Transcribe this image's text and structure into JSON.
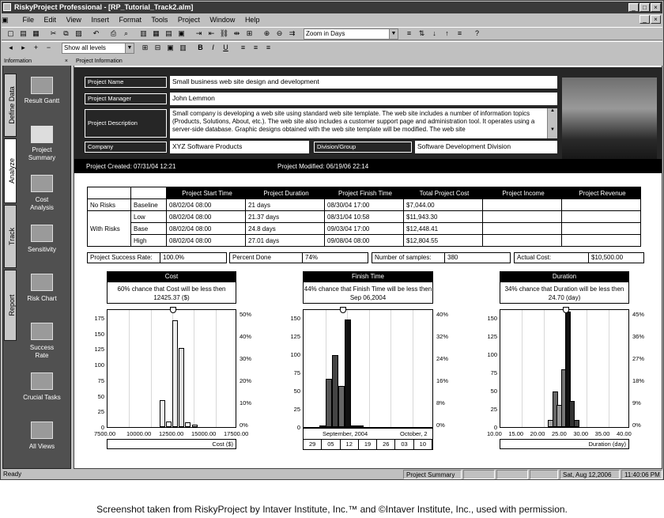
{
  "window": {
    "title": "RiskyProject Professional - [RP_Tutorial_Track2.alm]"
  },
  "menu": [
    "File",
    "Edit",
    "View",
    "Insert",
    "Format",
    "Tools",
    "Project",
    "Window",
    "Help"
  ],
  "toolbar": {
    "zoom_value": "Zoom in Days",
    "levels_value": "Show all levels",
    "bold": "B",
    "italic": "I",
    "underline": "U"
  },
  "sidebar": {
    "header": "Information",
    "tabs": [
      "Define Data",
      "Analyze",
      "Track",
      "Report"
    ],
    "items": [
      "Result Gantt",
      "Project Summary",
      "Cost Analysis",
      "Sensitivity",
      "Risk Chart",
      "Success Rate",
      "Crucial Tasks",
      "All Views"
    ]
  },
  "panel_header": "Project Information",
  "project": {
    "name_label": "Project Name",
    "name": "Small business web site design and development",
    "manager_label": "Project Manager",
    "manager": "John Lemmon",
    "description_label": "Project Description",
    "description": "Small company is developing a web site using standard web site template. The web site includes a number of information topics (Products, Solutions, About, etc.). The web site also includes a customer support page and administration tool. It operates using a server-side database. Graphic designs obtained with the web site template will be modified. The web site",
    "company_label": "Company",
    "company": "XYZ Software Products",
    "division_label": "Division/Group",
    "division": "Software Development Division",
    "created": "Project Created: 07/31/04 12:21",
    "modified": "Project Modified: 06/19/06 22:14"
  },
  "results": {
    "headers": [
      "",
      "",
      "Project Start Time",
      "Project Duration",
      "Project Finish Time",
      "Total Project Cost",
      "Project Income",
      "Project Revenue"
    ],
    "no_risks_label": "No Risks",
    "with_risks_label": "With Risks",
    "rows": [
      {
        "case": "Baseline",
        "start": "08/02/04 08:00",
        "duration": "21 days",
        "finish": "08/30/04 17:00",
        "cost": "$7,044.00"
      },
      {
        "case": "Low",
        "start": "08/02/04 08:00",
        "duration": "21.37 days",
        "finish": "08/31/04 10:58",
        "cost": "$11,943.30"
      },
      {
        "case": "Base",
        "start": "08/02/04 08:00",
        "duration": "24.8 days",
        "finish": "09/03/04 17:00",
        "cost": "$12,448.41"
      },
      {
        "case": "High",
        "start": "08/02/04 08:00",
        "duration": "27.01 days",
        "finish": "09/08/04 08:00",
        "cost": "$12,804.55"
      }
    ]
  },
  "stats": {
    "success_label": "Project Success Rate:",
    "success": "100.0%",
    "done_label": "Percent Done",
    "done": "74%",
    "samples_label": "Number of samples:",
    "samples": "380",
    "actual_label": "Actual Cost:",
    "actual": "$10,500.00"
  },
  "charts": [
    {
      "title": "Cost",
      "note": "60% chance that Cost will be less then 12425.37 ($)",
      "xbox": "Cost ($)",
      "xticks": [
        "7500.00",
        "10000.00",
        "12500.00",
        "15000.00",
        "17500.00"
      ],
      "yticks": [
        "175",
        "150",
        "125",
        "100",
        "75",
        "50",
        "25",
        "0"
      ],
      "ryticks": [
        "50%",
        "40%",
        "30%",
        "20%",
        "10%",
        "0%"
      ]
    },
    {
      "title": "Finish Time",
      "note": "44% chance that Finish Time will be less then Sep 06,2004",
      "xbox": "",
      "month_left": "September, 2004",
      "month_right": "October, 2",
      "days": [
        "29",
        "05",
        "12",
        "19",
        "26",
        "03",
        "10"
      ],
      "yticks": [
        "150",
        "125",
        "100",
        "75",
        "50",
        "25",
        "0"
      ],
      "ryticks": [
        "40%",
        "32%",
        "24%",
        "16%",
        "8%",
        "0%"
      ]
    },
    {
      "title": "Duration",
      "note": "34% chance that Duration will be less then 24.70 (day)",
      "xbox": "Duration (day)",
      "xticks": [
        "10.00",
        "15.00",
        "20.00",
        "25.00",
        "30.00",
        "35.00",
        "40.00"
      ],
      "yticks": [
        "150",
        "125",
        "100",
        "75",
        "50",
        "25",
        "0"
      ],
      "ryticks": [
        "45%",
        "36%",
        "27%",
        "18%",
        "9%",
        "0%"
      ]
    }
  ],
  "chart_data": [
    {
      "type": "bar",
      "title": "Cost",
      "xlabel": "Cost ($)",
      "xlim": [
        7500,
        17500
      ],
      "ylim": [
        0,
        200
      ],
      "x": [
        11500,
        12000,
        12500,
        13000,
        13500,
        14000
      ],
      "values": [
        45,
        10,
        180,
        133,
        8,
        4
      ]
    },
    {
      "type": "bar",
      "title": "Finish Time",
      "xlabel": "",
      "ylim": [
        0,
        160
      ],
      "x": [
        "08/31",
        "09/01",
        "09/02",
        "09/03",
        "09/06",
        "09/07",
        "09/08"
      ],
      "values": [
        2,
        65,
        97,
        55,
        145,
        2,
        1
      ]
    },
    {
      "type": "bar",
      "title": "Duration",
      "xlabel": "Duration (day)",
      "xlim": [
        10,
        40
      ],
      "ylim": [
        0,
        160
      ],
      "x": [
        21,
        22,
        23,
        24,
        25,
        26,
        27
      ],
      "values": [
        10,
        48,
        30,
        78,
        163,
        35,
        10
      ]
    }
  ],
  "status": {
    "ready": "Ready",
    "view": "Project Summary",
    "date": "Sat, Aug 12,2006",
    "time": "11:40:06 PM"
  },
  "caption": "Screenshot taken from RiskyProject by Intaver Institute, Inc.™ and ©Intaver Institute, Inc., used with permission."
}
